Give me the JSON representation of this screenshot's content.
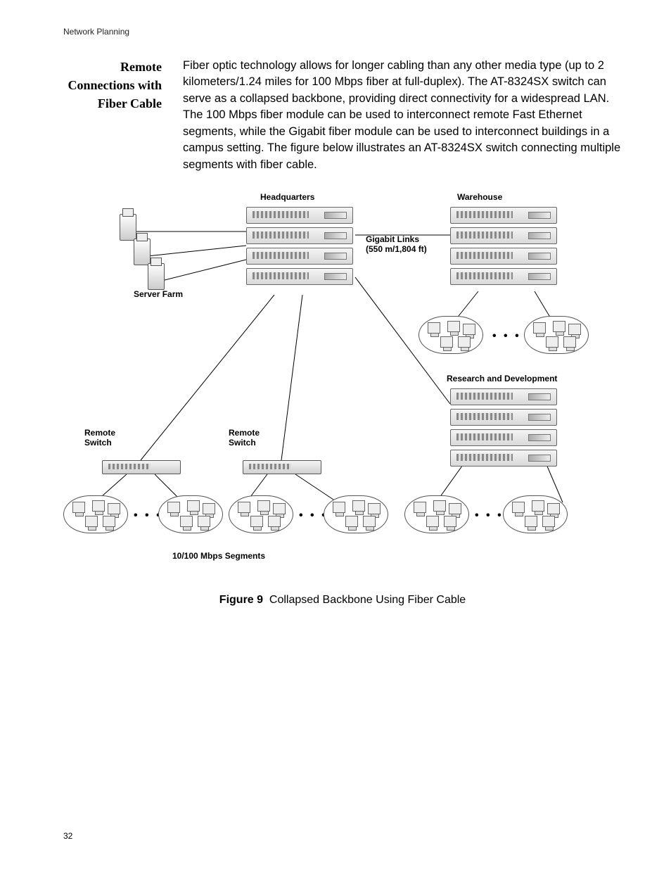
{
  "running_head": "Network Planning",
  "side_heading": "Remote Connections with Fiber Cable",
  "body_text": "Fiber optic technology allows for longer cabling than any other media type (up to 2 kilometers/1.24 miles for 100 Mbps fiber at full-duplex). The AT-8324SX switch can serve as a collapsed backbone, providing direct connectivity for a widespread LAN. The 100 Mbps fiber module can be used to interconnect remote Fast Ethernet segments, while the Gigabit fiber module can be used to interconnect buildings in a campus setting. The figure below illustrates an AT-8324SX switch connecting multiple segments with fiber cable.",
  "labels": {
    "headquarters": "Headquarters",
    "warehouse": "Warehouse",
    "gigabit_links_l1": "Gigabit Links",
    "gigabit_links_l2": "(550 m/1,804 ft)",
    "server_farm": "Server Farm",
    "research_dev": "Research and Development",
    "remote_switch": "Remote\nSwitch",
    "segments": "10/100 Mbps Segments"
  },
  "figure": {
    "number": "Figure 9",
    "caption": "Collapsed Backbone Using Fiber Cable"
  },
  "page_number": "32"
}
